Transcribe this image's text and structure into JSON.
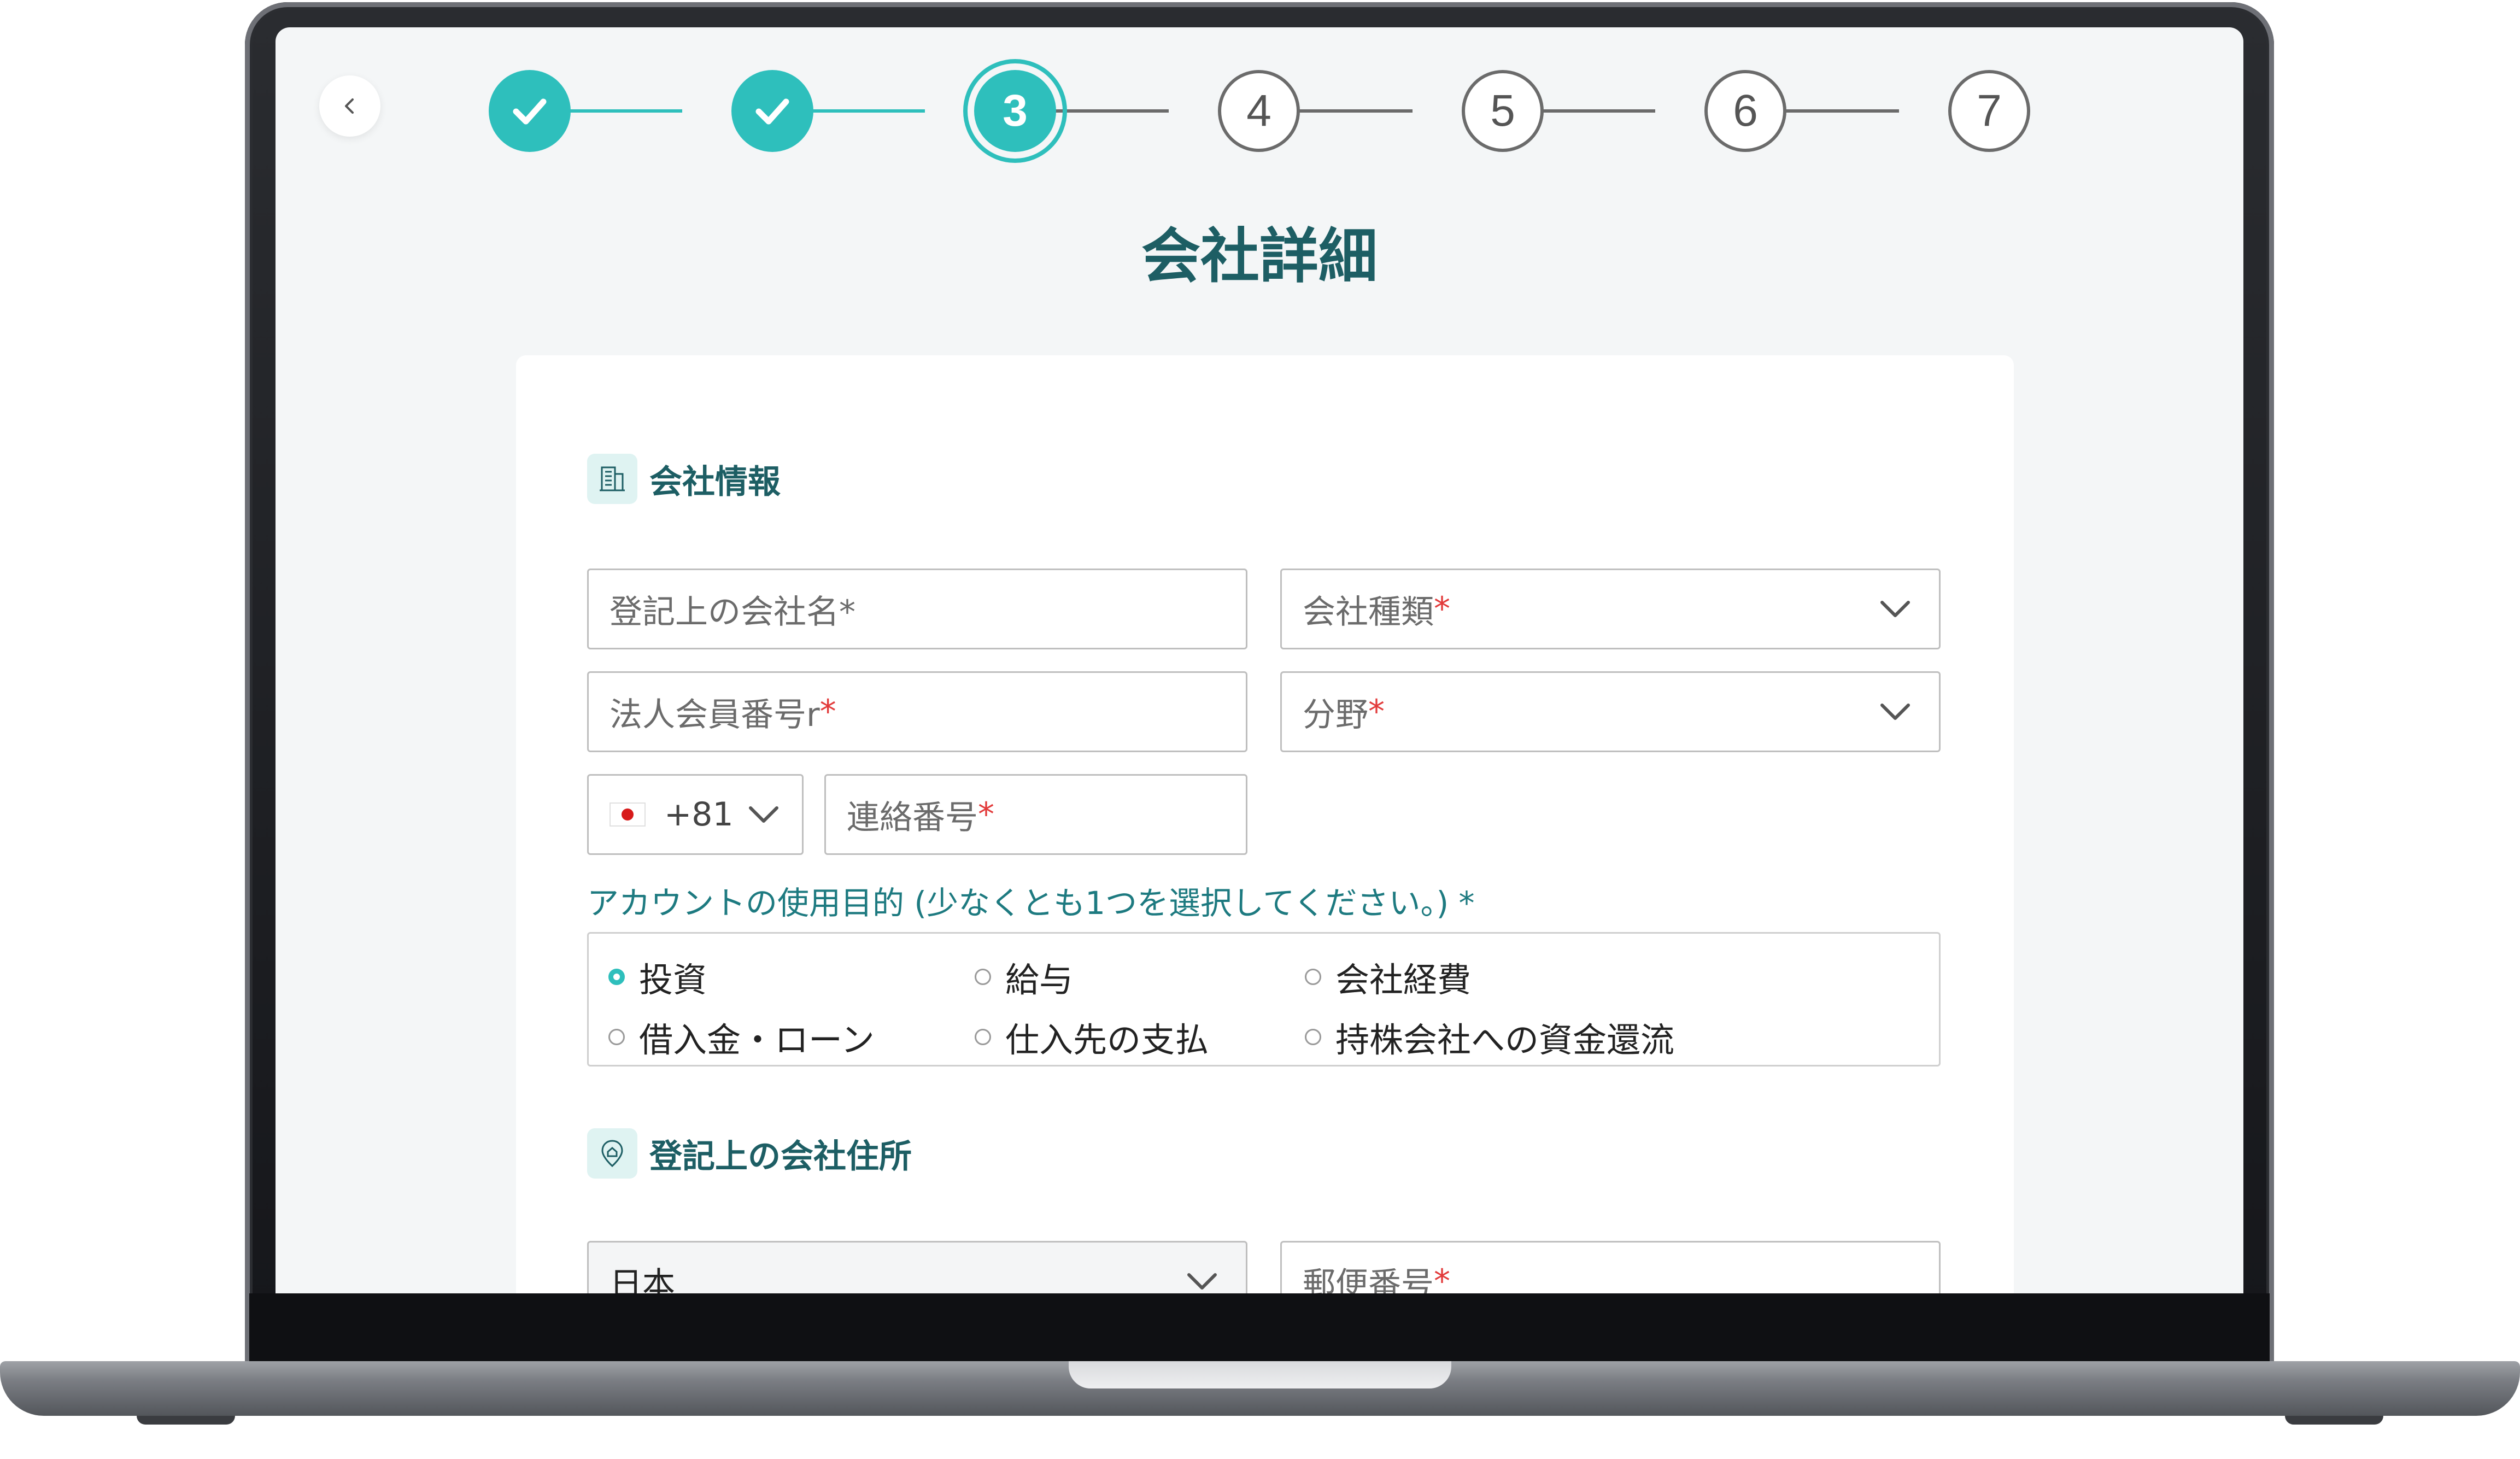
{
  "colors": {
    "accent": "#2ebfbc",
    "title": "#1d5e64",
    "required": "#e23b3b"
  },
  "stepper": {
    "steps": [
      {
        "label": "",
        "state": "done",
        "icon": "check-icon"
      },
      {
        "label": "",
        "state": "done",
        "icon": "check-icon"
      },
      {
        "label": "3",
        "state": "current"
      },
      {
        "label": "4",
        "state": "todo"
      },
      {
        "label": "5",
        "state": "todo"
      },
      {
        "label": "6",
        "state": "todo"
      },
      {
        "label": "7",
        "state": "todo"
      }
    ]
  },
  "page": {
    "title": "会社詳細"
  },
  "company_info": {
    "heading": "会社情報",
    "registered_name_placeholder": "登記上の会社名*",
    "company_type_placeholder": "会社種類",
    "corporate_number_placeholder": "法人会員番号r",
    "industry_placeholder": "分野",
    "phone_country_code": "+81",
    "phone_number_placeholder": "連絡番号",
    "required_mark": "*"
  },
  "purpose": {
    "label": "アカウントの使用目的 (少なくとも1つを選択してください。) *",
    "options": [
      {
        "label": "投資",
        "selected": true
      },
      {
        "label": "給与",
        "selected": false
      },
      {
        "label": "会社経費",
        "selected": false
      },
      {
        "label": "借入金・ローン",
        "selected": false
      },
      {
        "label": "仕入先の支払",
        "selected": false
      },
      {
        "label": "持株会社への資金還流",
        "selected": false
      }
    ]
  },
  "address": {
    "heading": "登記上の会社住所",
    "country_value": "日本",
    "postal_code_placeholder": "郵便番号"
  }
}
